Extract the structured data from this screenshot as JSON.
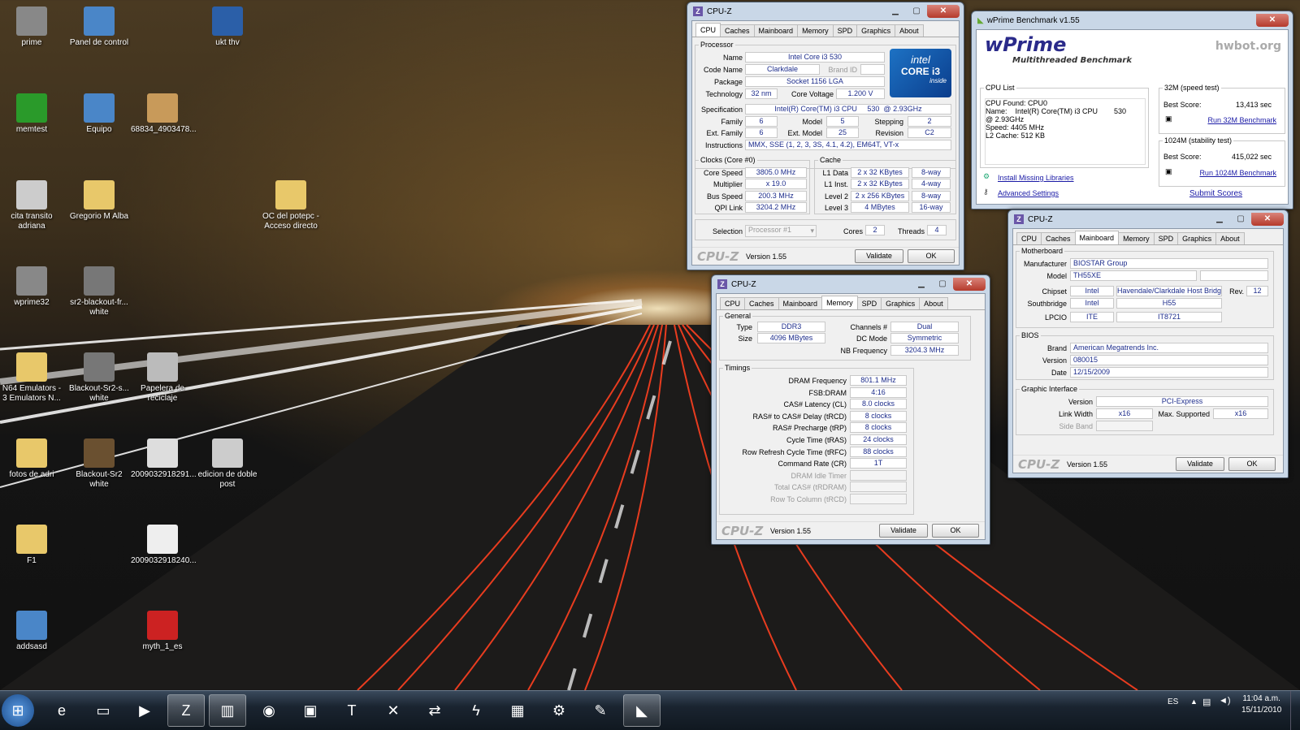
{
  "desktop_icons": [
    {
      "label": "prime",
      "icon": "app-icon",
      "color": "#888"
    },
    {
      "label": "Panel de control",
      "icon": "control-panel-icon",
      "color": "#4a86c8"
    },
    {
      "label": "ukt thv",
      "icon": "word-document-icon",
      "color": "#2b5fa8"
    },
    {
      "label": "memtest",
      "icon": "checkmark-icon",
      "color": "#2a9a2a"
    },
    {
      "label": "Equipo",
      "icon": "computer-icon",
      "color": "#4a86c8"
    },
    {
      "label": "68834_4903478...",
      "icon": "image-icon",
      "color": "#c89a5a"
    },
    {
      "label": "cita transito adriana",
      "icon": "image-icon",
      "color": "#ccc"
    },
    {
      "label": "Gregorio M Alba",
      "icon": "folder-icon",
      "color": "#e8c86a"
    },
    {
      "label": "OC del potepc - Acceso directo",
      "icon": "folder-shortcut-icon",
      "color": "#e8c86a"
    },
    {
      "label": "wprime32",
      "icon": "app-icon",
      "color": "#888"
    },
    {
      "label": "sr2-blackout-fr... white",
      "icon": "image-icon",
      "color": "#777"
    },
    {
      "label": "N64 Emulators - 3 Emulators N...",
      "icon": "folder-icon",
      "color": "#e8c86a"
    },
    {
      "label": "Blackout-Sr2-s... white",
      "icon": "image-icon",
      "color": "#777"
    },
    {
      "label": "Papelera de reciclaje",
      "icon": "recycle-bin-icon",
      "color": "#bbb"
    },
    {
      "label": "fotos de adri",
      "icon": "folder-icon",
      "color": "#e8c86a"
    },
    {
      "label": "Blackout-Sr2 white",
      "icon": "image-icon",
      "color": "#6a5030"
    },
    {
      "label": "2009032918291...",
      "icon": "image-icon",
      "color": "#ddd"
    },
    {
      "label": "edicion de doble post",
      "icon": "image-icon",
      "color": "#ccc"
    },
    {
      "label": "F1",
      "icon": "folder-icon",
      "color": "#e8c86a"
    },
    {
      "label": "2009032918240...",
      "icon": "image-icon",
      "color": "#eee"
    },
    {
      "label": "addsasd",
      "icon": "image-icon",
      "color": "#4a86c8"
    },
    {
      "label": "myth_1_es",
      "icon": "pdf-icon",
      "color": "#c22"
    }
  ],
  "cpuz_cpu": {
    "title": "CPU-Z",
    "tabs": [
      "CPU",
      "Caches",
      "Mainboard",
      "Memory",
      "SPD",
      "Graphics",
      "About"
    ],
    "processor_legend": "Processor",
    "name_lbl": "Name",
    "name": "Intel Core i3 530",
    "codename_lbl": "Code Name",
    "codename": "Clarkdale",
    "brandid_lbl": "Brand ID",
    "package_lbl": "Package",
    "package": "Socket 1156 LGA",
    "tech_lbl": "Technology",
    "tech": "32 nm",
    "voltage_lbl": "Core Voltage",
    "voltage": "1.200 V",
    "spec_lbl": "Specification",
    "spec": "Intel(R) Core(TM) i3 CPU     530  @ 2.93GHz",
    "family_lbl": "Family",
    "family": "6",
    "model_lbl": "Model",
    "model": "5",
    "stepping_lbl": "Stepping",
    "stepping": "2",
    "extfamily_lbl": "Ext. Family",
    "extfamily": "6",
    "extmodel_lbl": "Ext. Model",
    "extmodel": "25",
    "revision_lbl": "Revision",
    "revision": "C2",
    "instr_lbl": "Instructions",
    "instr": "MMX, SSE (1, 2, 3, 3S, 4.1, 4.2), EM64T, VT-x",
    "clocks_legend": "Clocks (Core #0)",
    "corespeed_lbl": "Core Speed",
    "corespeed": "3805.0 MHz",
    "mult_lbl": "Multiplier",
    "mult": "x 19.0",
    "bus_lbl": "Bus Speed",
    "bus": "200.3 MHz",
    "qpi_lbl": "QPI Link",
    "qpi": "3204.2 MHz",
    "cache_legend": "Cache",
    "l1d_lbl": "L1 Data",
    "l1d": "2 x 32 KBytes",
    "l1d_way": "8-way",
    "l1i_lbl": "L1 Inst.",
    "l1i": "2 x 32 KBytes",
    "l1i_way": "4-way",
    "l2_lbl": "Level 2",
    "l2": "2 x 256 KBytes",
    "l2_way": "8-way",
    "l3_lbl": "Level 3",
    "l3": "4 MBytes",
    "l3_way": "16-way",
    "selection_lbl": "Selection",
    "selection": "Processor #1",
    "cores_lbl": "Cores",
    "cores": "2",
    "threads_lbl": "Threads",
    "threads": "4",
    "intel_brand": "intel",
    "intel_core": "CORE i3",
    "intel_inside": "inside",
    "logo": "CPU-Z",
    "version": "Version 1.55",
    "validate": "Validate",
    "ok": "OK"
  },
  "cpuz_mem": {
    "title": "CPU-Z",
    "tabs": [
      "CPU",
      "Caches",
      "Mainboard",
      "Memory",
      "SPD",
      "Graphics",
      "About"
    ],
    "general_legend": "General",
    "type_lbl": "Type",
    "type": "DDR3",
    "channels_lbl": "Channels #",
    "channels": "Dual",
    "size_lbl": "Size",
    "size": "4096 MBytes",
    "dcmode_lbl": "DC Mode",
    "dcmode": "Symmetric",
    "nbfreq_lbl": "NB Frequency",
    "nbfreq": "3204.3 MHz",
    "timings_legend": "Timings",
    "t": [
      {
        "lbl": "DRAM Frequency",
        "val": "801.1 MHz"
      },
      {
        "lbl": "FSB:DRAM",
        "val": "4:16"
      },
      {
        "lbl": "CAS# Latency (CL)",
        "val": "8.0 clocks"
      },
      {
        "lbl": "RAS# to CAS# Delay (tRCD)",
        "val": "8 clocks"
      },
      {
        "lbl": "RAS# Precharge (tRP)",
        "val": "8 clocks"
      },
      {
        "lbl": "Cycle Time (tRAS)",
        "val": "24 clocks"
      },
      {
        "lbl": "Row Refresh Cycle Time (tRFC)",
        "val": "88 clocks"
      },
      {
        "lbl": "Command Rate (CR)",
        "val": "1T"
      },
      {
        "lbl": "DRAM Idle Timer",
        "val": ""
      },
      {
        "lbl": "Total CAS# (tRDRAM)",
        "val": ""
      },
      {
        "lbl": "Row To Column (tRCD)",
        "val": ""
      }
    ],
    "logo": "CPU-Z",
    "version": "Version 1.55",
    "validate": "Validate",
    "ok": "OK"
  },
  "cpuz_mb": {
    "title": "CPU-Z",
    "tabs": [
      "CPU",
      "Caches",
      "Mainboard",
      "Memory",
      "SPD",
      "Graphics",
      "About"
    ],
    "mb_legend": "Motherboard",
    "manu_lbl": "Manufacturer",
    "manu": "BIOSTAR Group",
    "model_lbl": "Model",
    "model": "TH55XE",
    "chipset_lbl": "Chipset",
    "chipset_v": "Intel",
    "chipset": "Havendale/Clarkdale Host Bridge",
    "rev_lbl": "Rev.",
    "rev": "12",
    "south_lbl": "Southbridge",
    "south_v": "Intel",
    "south": "H55",
    "lpcio_lbl": "LPCIO",
    "lpcio_v": "ITE",
    "lpcio": "IT8721",
    "bios_legend": "BIOS",
    "brand_lbl": "Brand",
    "brand": "American Megatrends Inc.",
    "version_lbl": "Version",
    "version_v": "080015",
    "date_lbl": "Date",
    "date": "12/15/2009",
    "gi_legend": "Graphic Interface",
    "giver_lbl": "Version",
    "giver": "PCI-Express",
    "lw_lbl": "Link Width",
    "lw": "x16",
    "max_lbl": "Max. Supported",
    "max": "x16",
    "sb_lbl": "Side Band",
    "logo": "CPU-Z",
    "version": "Version 1.55",
    "validate": "Validate",
    "ok": "OK"
  },
  "wprime": {
    "title": "wPrime Benchmark v1.55",
    "logo": "wPrime",
    "subtitle": "Multithreaded Benchmark",
    "hwbot": "hwbot.org",
    "cpulist_legend": "CPU List",
    "cpu_lines": [
      "CPU Found: CPU0",
      "Name:    Intel(R) Core(TM) i3 CPU        530",
      "@ 2.93GHz",
      "Speed:   4405 MHz",
      "L2 Cache: 512 KB"
    ],
    "install": "Install Missing Libraries",
    "advanced": "Advanced Settings",
    "t32_legend": "32M (speed test)",
    "best_lbl": "Best Score:",
    "t32_score": "13,413 sec",
    "t32_run": "Run 32M Benchmark",
    "t1024_legend": "1024M (stability test)",
    "t1024_score": "415,022 sec",
    "t1024_run": "Run 1024M Benchmark",
    "submit": "Submit Scores"
  },
  "taskbar": {
    "lang": "ES",
    "time": "11:04 a.m.",
    "date": "15/11/2010",
    "apps": [
      "start-orb-icon",
      "internet-explorer-icon",
      "explorer-folder-icon",
      "media-player-icon",
      "cpuz-icon",
      "winrar-icon",
      "firefox-icon",
      "monitor-app-icon",
      "text-app-icon",
      "xbox-app-icon",
      "link-app-icon",
      "flash-icon",
      "notepad-icon",
      "settings-gear-icon",
      "tool-app-icon",
      "wprime-icon"
    ]
  }
}
